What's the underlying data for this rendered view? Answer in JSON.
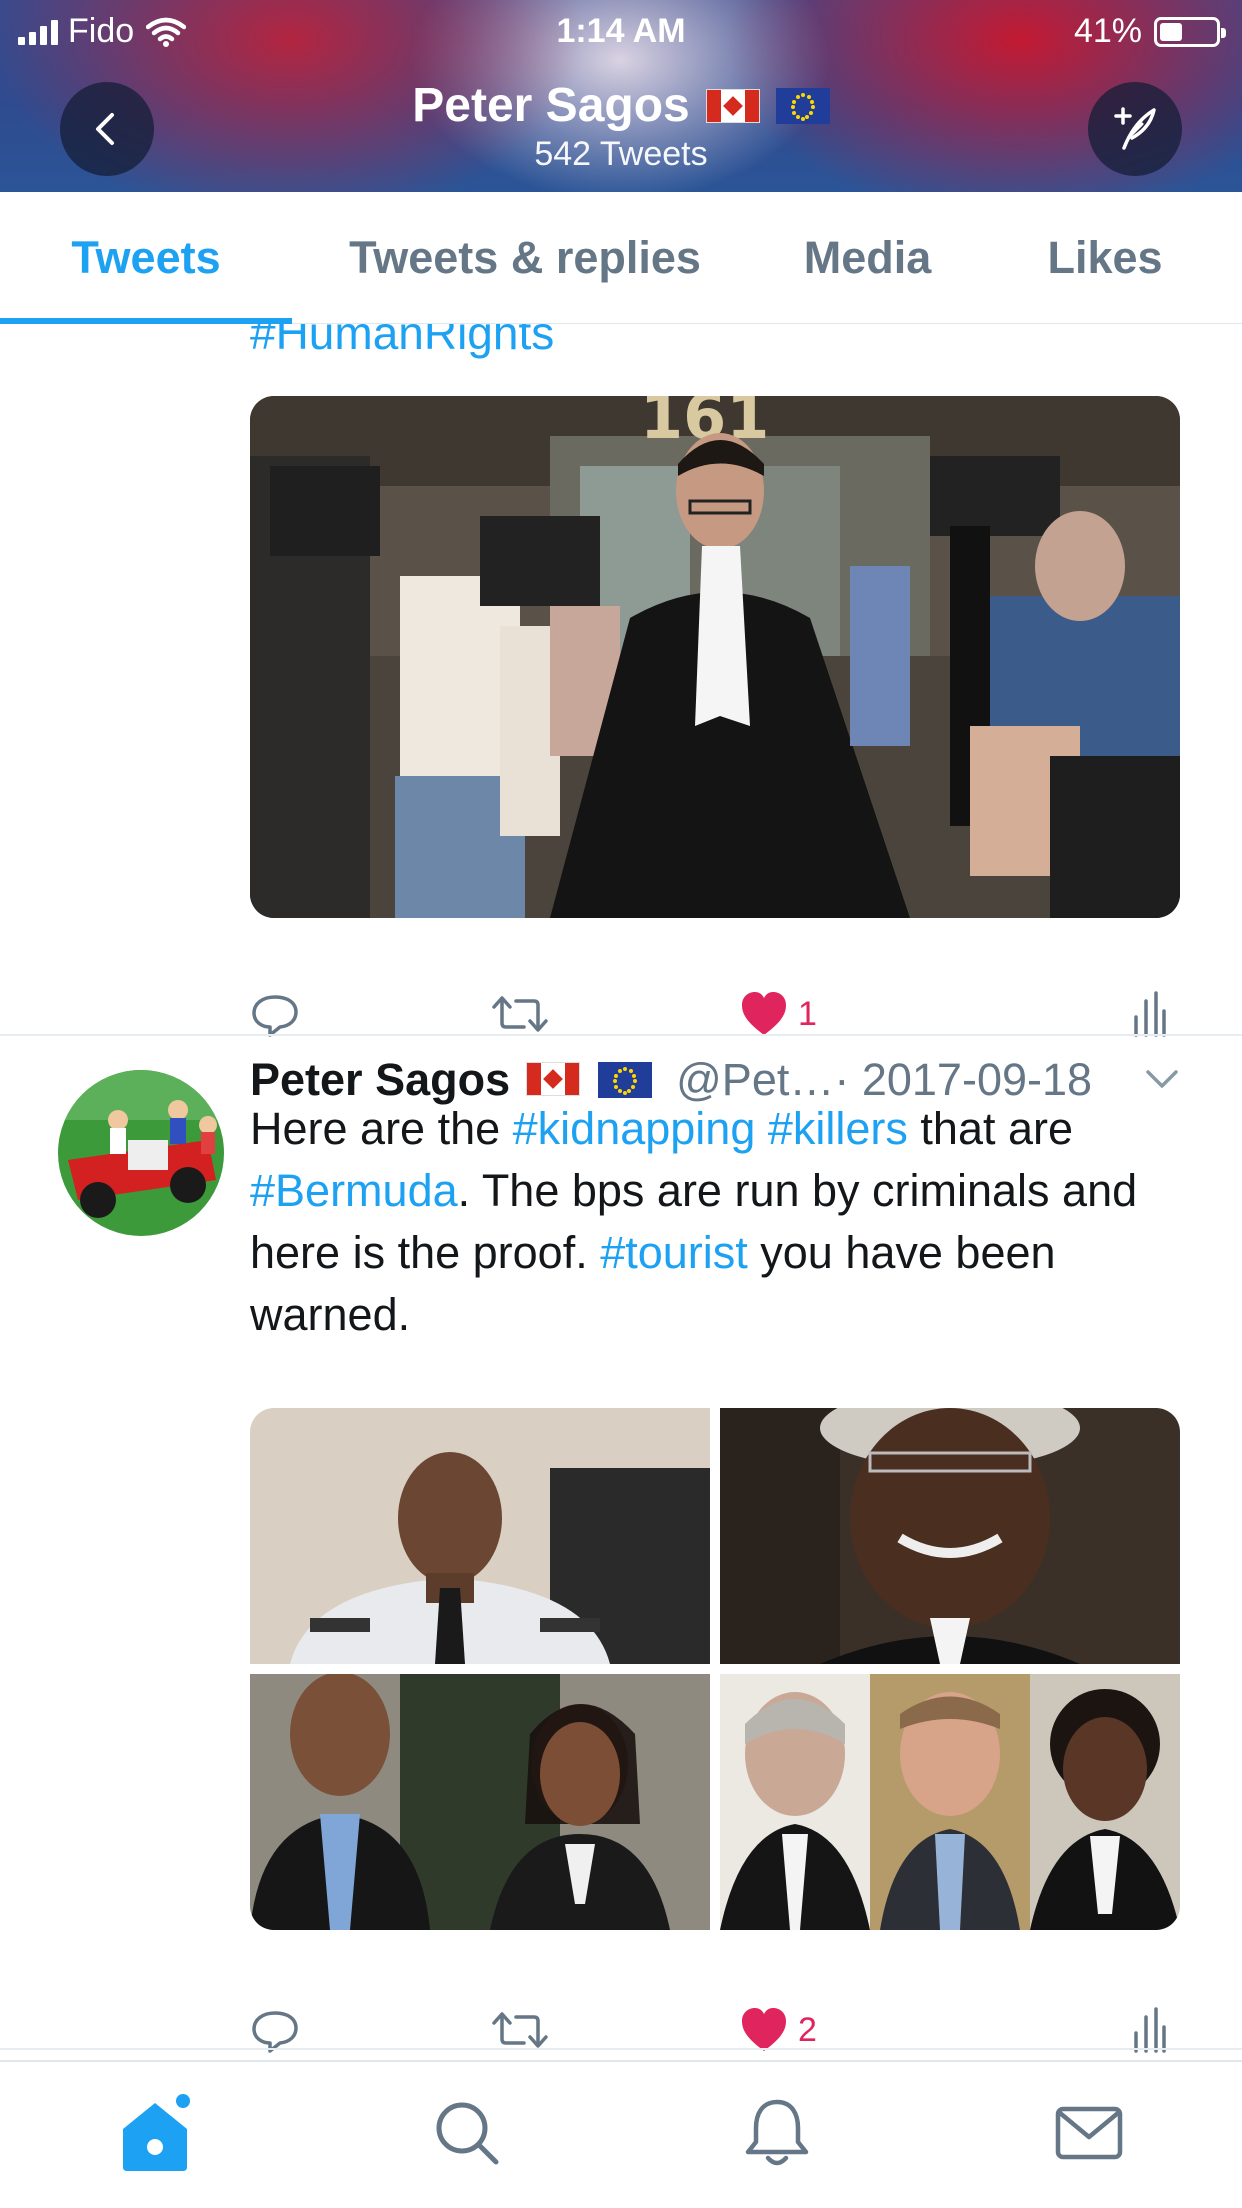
{
  "status_bar": {
    "carrier": "Fido",
    "time": "1:14 AM",
    "battery_percent_text": "41%",
    "battery_level": 0.41
  },
  "header": {
    "name": "Peter Sagos",
    "tweet_count": "542 Tweets",
    "back_icon": "chevron-left-icon",
    "compose_icon": "compose-tweet-icon"
  },
  "tabs": [
    {
      "label": "Tweets",
      "active": true
    },
    {
      "label": "Tweets & replies",
      "active": false
    },
    {
      "label": "Media",
      "active": false
    },
    {
      "label": "Likes",
      "active": false
    }
  ],
  "feed": {
    "previous_tweet": {
      "cut_text": "#HumanRights",
      "like_count": "1"
    },
    "tweet": {
      "name": "Peter Sagos",
      "handle": "@Pet…",
      "date": "· 2017-09-18",
      "text_1": "Here are the ",
      "tag_1": "#kidnapping",
      "text_2": " ",
      "tag_2": "#killers",
      "text_3": " that are ",
      "tag_3": "#Bermuda",
      "text_4": ". The bps are run by criminals and here is the proof. ",
      "tag_4": "#tourist",
      "text_5": " you have been warned.",
      "like_count": "2"
    }
  },
  "bottom_nav": [
    "home-icon",
    "search-icon",
    "notifications-icon",
    "messages-icon"
  ],
  "colors": {
    "accent": "#1da1f2",
    "like": "#e0245e",
    "secondary_text": "#657786"
  }
}
